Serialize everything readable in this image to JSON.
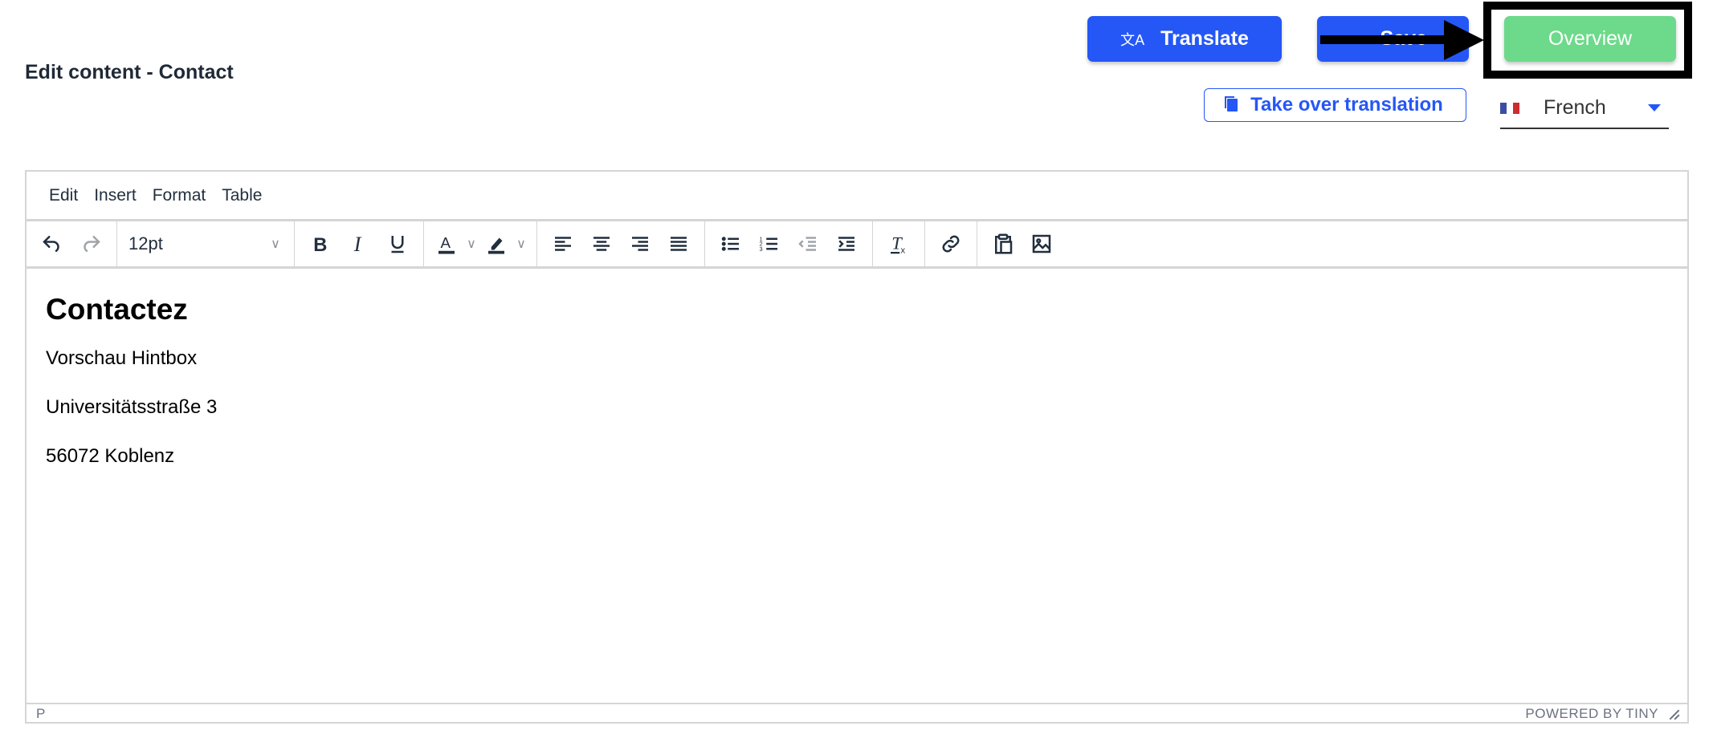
{
  "page": {
    "title": "Edit content - Contact"
  },
  "header_buttons": {
    "translate": {
      "label": "Translate",
      "icon": "translate-icon"
    },
    "save": {
      "label": "Save",
      "icon": "save-icon"
    },
    "overview": {
      "label": "Overview"
    },
    "take_over": {
      "label": "Take over translation",
      "icon": "copy-document-icon"
    }
  },
  "language_select": {
    "selected": "French",
    "flag_colors": [
      "#3b4ea3",
      "#ffffff",
      "#d02b30"
    ]
  },
  "colors": {
    "primary": "#2557f6",
    "overview": "#6cda8a",
    "annotation": "#000000"
  },
  "editor": {
    "menubar": [
      "Edit",
      "Insert",
      "Format",
      "Table"
    ],
    "font_size": "12pt",
    "toolbar_icons": [
      "undo-icon",
      "redo-icon",
      "bold-icon",
      "italic-icon",
      "underline-icon",
      "text-color-icon",
      "highlight-color-icon",
      "align-left-icon",
      "align-center-icon",
      "align-right-icon",
      "align-justify-icon",
      "bullet-list-icon",
      "numbered-list-icon",
      "outdent-icon",
      "indent-icon",
      "clear-formatting-icon",
      "link-icon",
      "paste-icon",
      "image-icon"
    ],
    "content": {
      "heading": "Contactez",
      "paragraphs": [
        "Vorschau Hintbox",
        "Universitätsstraße 3",
        "56072 Koblenz"
      ]
    },
    "status": {
      "path": "P",
      "branding": "POWERED BY TINY"
    }
  }
}
